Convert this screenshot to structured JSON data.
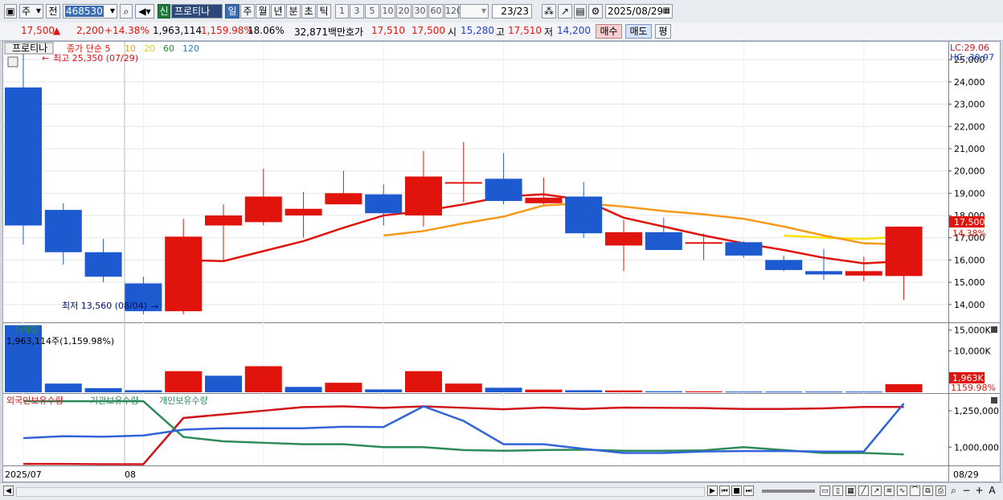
{
  "toolbar": {
    "period_type": "주",
    "market": "전",
    "code": "468530",
    "credit_badge": "신",
    "stock_name": "프로티나",
    "periods": [
      "일",
      "주",
      "월",
      "년",
      "분",
      "초",
      "틱"
    ],
    "active_period": "일",
    "intervals": [
      "1",
      "3",
      "5",
      "10",
      "20",
      "30",
      "60",
      "120"
    ],
    "page_count": "23/23",
    "date": "2025/08/29"
  },
  "quote": {
    "price": "17,500",
    "change": "2,200",
    "change_pct": "+14.38%",
    "volume": "1,963,114",
    "volume_ratio": "1,159.98%",
    "turnover": "18.06%",
    "amount": "32,871백만",
    "hoga_label": "호가",
    "ask": "17,510",
    "bid": "17,500",
    "open_label": "시",
    "open": "15,280",
    "high_label": "고",
    "high": "17,510",
    "low_label": "저",
    "low": "14,200",
    "buy_label": "매수",
    "sell_label": "매도",
    "avg_label": "평"
  },
  "colors": {
    "up": "#e0140c",
    "down": "#1d5ad0",
    "ma5": "#e0140c",
    "ma10": "#f59a1a",
    "ma20": "#ffe000",
    "ma60": "#2a8a2a",
    "ma120": "#2a7abf",
    "foreign": "#d0141a",
    "inst": "#2e8a58",
    "indiv": "#3064d8"
  },
  "price_panel": {
    "stock_tag": "프로티나",
    "legend": [
      {
        "label": "종가 단순 5",
        "color": "#e0140c"
      },
      {
        "label": "10",
        "color": "#f5a000"
      },
      {
        "label": "20",
        "color": "#e8d000"
      },
      {
        "label": "60",
        "color": "#2a8a2a"
      },
      {
        "label": "120",
        "color": "#2a7abf"
      }
    ],
    "max_note": "최고 25,350 (07/29)",
    "min_note": "최저 13,560 (08/04)",
    "lc": "LC:29.06",
    "hc": "HC:-30.97",
    "last_price_tag": "17,500",
    "last_pct_tag": "14.38%"
  },
  "volume_panel": {
    "title": "거래량",
    "info": "1,963,114주(1,159.98%)",
    "last_tag": "1,963K",
    "last_pct": "1159.98%"
  },
  "holdings_panel": {
    "legend": [
      "외국인보유수량",
      "기관보유수량",
      "개인보유수량"
    ]
  },
  "xaxis": {
    "start": "2025/07",
    "mid": "08",
    "end": "08/29"
  },
  "chart_data": [
    {
      "type": "candlestick",
      "ylim": [
        13200,
        25800
      ],
      "yticks": [
        14000,
        15000,
        16000,
        17000,
        18000,
        19000,
        20000,
        21000,
        22000,
        23000,
        24000,
        25000
      ],
      "candles": [
        {
          "o": 23750,
          "h": 25350,
          "l": 16700,
          "c": 17550
        },
        {
          "o": 18250,
          "h": 18550,
          "l": 15800,
          "c": 16350
        },
        {
          "o": 16350,
          "h": 16950,
          "l": 15000,
          "c": 15250
        },
        {
          "o": 14950,
          "h": 15250,
          "l": 13560,
          "c": 13700
        },
        {
          "o": 13700,
          "h": 17850,
          "l": 13560,
          "c": 17050
        },
        {
          "o": 17550,
          "h": 18500,
          "l": 16000,
          "c": 18000
        },
        {
          "o": 17700,
          "h": 20100,
          "l": 17550,
          "c": 18850
        },
        {
          "o": 18000,
          "h": 19050,
          "l": 17000,
          "c": 18300
        },
        {
          "o": 18500,
          "h": 20000,
          "l": 18500,
          "c": 19000
        },
        {
          "o": 18950,
          "h": 19400,
          "l": 17550,
          "c": 18100
        },
        {
          "o": 18000,
          "h": 20900,
          "l": 17500,
          "c": 19750
        },
        {
          "o": 19500,
          "h": 21300,
          "l": 18600,
          "c": 19500
        },
        {
          "o": 19650,
          "h": 20800,
          "l": 18500,
          "c": 18650
        },
        {
          "o": 18550,
          "h": 19700,
          "l": 18500,
          "c": 18800
        },
        {
          "o": 18850,
          "h": 19500,
          "l": 17000,
          "c": 17200
        },
        {
          "o": 16650,
          "h": 17800,
          "l": 15500,
          "c": 17250
        },
        {
          "o": 17250,
          "h": 17900,
          "l": 16450,
          "c": 16450
        },
        {
          "o": 16800,
          "h": 17200,
          "l": 16000,
          "c": 16800
        },
        {
          "o": 16800,
          "h": 16850,
          "l": 16100,
          "c": 16200
        },
        {
          "o": 16000,
          "h": 16200,
          "l": 15500,
          "c": 15550
        },
        {
          "o": 15500,
          "h": 16500,
          "l": 15100,
          "c": 15350
        },
        {
          "o": 15300,
          "h": 16150,
          "l": 15050,
          "c": 15500
        },
        {
          "o": 15280,
          "h": 17510,
          "l": 14200,
          "c": 17500
        }
      ],
      "ma5": [
        null,
        null,
        null,
        null,
        16000,
        15950,
        16400,
        16850,
        17450,
        18000,
        18200,
        18500,
        18850,
        18950,
        18700,
        17900,
        17500,
        17100,
        16750,
        16450,
        16100,
        15850,
        15950
      ],
      "ma10": [
        null,
        null,
        null,
        null,
        null,
        null,
        null,
        null,
        null,
        17100,
        17300,
        17650,
        17950,
        18450,
        18550,
        18400,
        18200,
        18050,
        17850,
        17500,
        17100,
        16750,
        16700
      ],
      "ma20": [
        null,
        null,
        null,
        null,
        null,
        null,
        null,
        null,
        null,
        null,
        null,
        null,
        null,
        null,
        null,
        null,
        null,
        null,
        null,
        17100,
        17000,
        16950,
        17050
      ]
    },
    {
      "type": "bar",
      "name": "volume",
      "ylim": [
        0,
        16500
      ],
      "yticks": [
        10000,
        15000
      ],
      "ytick_labels": [
        "10,000K",
        "15,000K"
      ],
      "values": [
        16200,
        2100,
        1000,
        500,
        5100,
        4000,
        6300,
        1300,
        2300,
        700,
        5100,
        2100,
        1100,
        650,
        500,
        450,
        250,
        230,
        170,
        170,
        170,
        170,
        1963
      ],
      "up": [
        false,
        false,
        false,
        false,
        true,
        false,
        true,
        false,
        true,
        false,
        true,
        true,
        false,
        true,
        false,
        true,
        false,
        true,
        false,
        false,
        false,
        false,
        true
      ]
    },
    {
      "type": "line",
      "name": "holdings",
      "ylim": [
        880000,
        1360000
      ],
      "yticks": [
        1000000,
        1250000
      ],
      "ytick_labels": [
        "1,000,000",
        "1,250,000"
      ],
      "series": [
        {
          "name": "외국인보유수량",
          "values": [
            885000,
            885000,
            883000,
            883000,
            1200000,
            1225000,
            1250000,
            1275000,
            1280000,
            1270000,
            1280000,
            1270000,
            1260000,
            1272000,
            1262000,
            1272000,
            1270000,
            1268000,
            1262000,
            1262000,
            1266000,
            1276000,
            1276000
          ]
        },
        {
          "name": "기관보유수량",
          "values": [
            1315000,
            1315000,
            1315000,
            1315000,
            1070000,
            1040000,
            1030000,
            1020000,
            1020000,
            1000000,
            1000000,
            980000,
            975000,
            980000,
            983000,
            975000,
            975000,
            978000,
            1000000,
            980000,
            960000,
            960000,
            950000
          ]
        },
        {
          "name": "개인보유수량",
          "values": [
            1062000,
            1075000,
            1072000,
            1080000,
            1120000,
            1130000,
            1130000,
            1130000,
            1140000,
            1138000,
            1280000,
            1180000,
            1020000,
            1020000,
            988000,
            960000,
            960000,
            970000,
            973000,
            973000,
            970000,
            970000,
            1300000
          ]
        }
      ]
    }
  ]
}
